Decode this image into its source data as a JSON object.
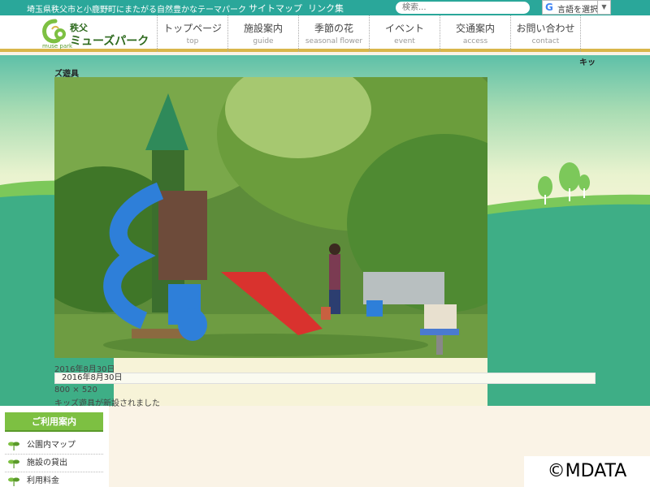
{
  "topbar": {
    "tagline": "埼玉県秩父市と小鹿野町にまたがる自然豊かなテーマパーク",
    "links": [
      "サイトマップ",
      "リンク集"
    ],
    "search_placeholder": "検索...",
    "language_label": "言語を選択",
    "language_icon_text": "G"
  },
  "header": {
    "logo_line1": "秩父",
    "logo_line2": "ミューズパーク",
    "logo_sub": "muse park",
    "nav": [
      {
        "jp": "トップページ",
        "en": "top"
      },
      {
        "jp": "施設案内",
        "en": "guide"
      },
      {
        "jp": "季節の花",
        "en": "seasonal flower"
      },
      {
        "jp": "イベント",
        "en": "event"
      },
      {
        "jp": "交通案内",
        "en": "access"
      },
      {
        "jp": "お問い合わせ",
        "en": "contact"
      }
    ]
  },
  "content": {
    "breadcrumb_tail": "キッ",
    "image_title": "ズ遊具",
    "date": "2016年8月30日",
    "date_field": "2016年8月30日",
    "size": "800 × 520",
    "caption": "キッズ遊具が新設されました"
  },
  "sidebar": {
    "heading": "ご利用案内",
    "items": [
      "公園内マップ",
      "施設の貸出",
      "利用料金"
    ]
  },
  "watermark": "©MDATA",
  "colors": {
    "brand_teal": "#2aa79a",
    "accent_gold": "#d9b64a",
    "sidebar_green": "#7dc042"
  }
}
